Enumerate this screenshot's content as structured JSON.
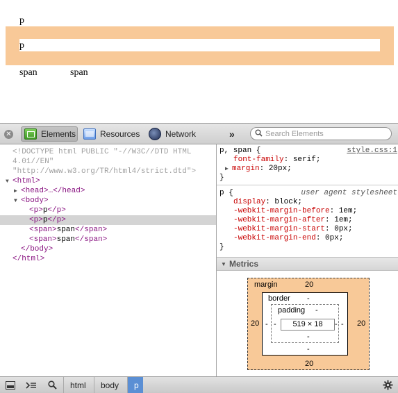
{
  "page": {
    "p1_text": "p",
    "p2_text": "p",
    "span1_text": "span",
    "span2_text": "span",
    "highlight_color": "#f8c998"
  },
  "toolbar": {
    "close_icon": "close-icon",
    "tabs": [
      {
        "label": "Elements",
        "icon": "elements-icon",
        "active": true
      },
      {
        "label": "Resources",
        "icon": "resources-icon",
        "active": false
      },
      {
        "label": "Network",
        "icon": "network-icon",
        "active": false
      }
    ],
    "more": "»",
    "search_placeholder": "Search Elements"
  },
  "dom_tree": {
    "doctype_1": "<!DOCTYPE html PUBLIC \"-//W3C//DTD HTML",
    "doctype_2": "4.01//EN\"",
    "doctype_3": "\"http://www.w3.org/TR/html4/strict.dtd\">",
    "html_open": "<html>",
    "head": "<head>…</head>",
    "body_open": "<body>",
    "p1_open": "<p>",
    "p1_text": "p",
    "p1_close": "</p>",
    "p2_open": "<p>",
    "p2_text": "p",
    "p2_close": "</p>",
    "span1_open": "<span>",
    "span1_text": "span",
    "span1_close": "</span>",
    "span2_open": "<span>",
    "span2_text": "span",
    "span2_close": "</span>",
    "body_close": "</body>",
    "html_close": "</html>"
  },
  "styles": {
    "rule1": {
      "selector": "p, span {",
      "source": "style.css:1",
      "props": [
        {
          "name": "font-family",
          "value": "serif;"
        },
        {
          "name": "margin",
          "value": "20px;"
        }
      ],
      "close": "}"
    },
    "rule2": {
      "selector": "p {",
      "source": "user agent stylesheet",
      "props": [
        {
          "name": "display",
          "value": "block;"
        },
        {
          "name": "-webkit-margin-before",
          "value": "1em;"
        },
        {
          "name": "-webkit-margin-after",
          "value": "1em;"
        },
        {
          "name": "-webkit-margin-start",
          "value": "0px;"
        },
        {
          "name": "-webkit-margin-end",
          "value": "0px;"
        }
      ],
      "close": "}"
    }
  },
  "metrics": {
    "title": "Metrics",
    "margin_label": "margin",
    "margin_top": "20",
    "margin_right": "20",
    "margin_bottom": "20",
    "margin_left": "20",
    "border_label": "border",
    "border_top": "-",
    "border_right": "-",
    "border_bottom": "-",
    "border_left": "-",
    "padding_label": "padding",
    "padding_top": "-",
    "padding_right": "-",
    "padding_bottom": "-",
    "padding_left": "-",
    "content_size": "519 × 18",
    "margin_color": "#f8c998"
  },
  "bottom_bar": {
    "breadcrumbs": [
      "html",
      "body",
      "p"
    ],
    "active_crumb": "p"
  }
}
